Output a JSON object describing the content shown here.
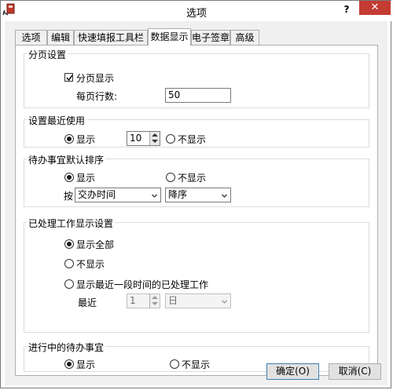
{
  "window": {
    "title": "选项",
    "help": "?",
    "close": "✕"
  },
  "tabs": [
    {
      "label": "选项"
    },
    {
      "label": "编辑"
    },
    {
      "label": "快速填报工具栏"
    },
    {
      "label": "数据显示",
      "active": true
    },
    {
      "label": "电子签章"
    },
    {
      "label": "高级"
    }
  ],
  "paging": {
    "title": "分页设置",
    "checkbox_label": "分页显示",
    "checked": true,
    "rows_label": "每页行数:",
    "rows_value": "50"
  },
  "recent": {
    "title": "设置最近使用",
    "show_label": "显示",
    "count_value": "10",
    "hide_label": "不显示",
    "selected": "show"
  },
  "todo_sort": {
    "title": "待办事宜默认排序",
    "show_label": "显示",
    "hide_label": "不显示",
    "selected": "show",
    "by_label": "按",
    "field_value": "交办时间",
    "order_value": "降序"
  },
  "processed": {
    "title": "已处理工作显示设置",
    "option_all": "显示全部",
    "option_none": "不显示",
    "option_recent": "显示最近一段时间的已处理工作",
    "selected": "all",
    "recent_label": "最近",
    "recent_value": "1",
    "unit_value": "日"
  },
  "in_progress": {
    "title": "进行中的待办事宜",
    "show_label": "显示",
    "hide_label": "不显示",
    "selected": "show"
  },
  "buttons": {
    "ok": "确定(O)",
    "cancel": "取消(C)"
  },
  "colors": {
    "close_bg": "#c43b32",
    "panel_bg": "#f0f0f0"
  }
}
